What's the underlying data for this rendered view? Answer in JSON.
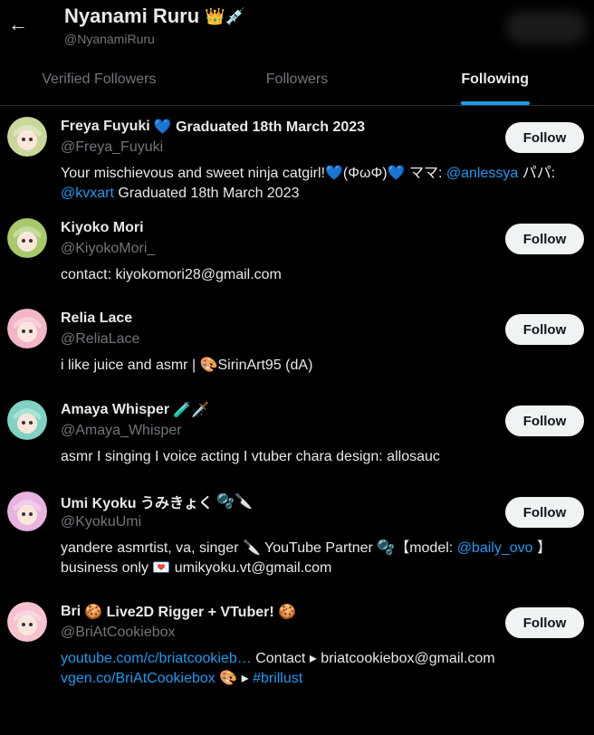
{
  "header": {
    "title": "Nyanami Ruru",
    "title_emoji": "👑💉",
    "handle": "@NyanamiRuru",
    "back_icon": "←"
  },
  "tabs": [
    {
      "label": "Verified Followers"
    },
    {
      "label": "Followers"
    },
    {
      "label": "Following"
    }
  ],
  "follow_label": "Follow",
  "users": [
    {
      "name": "Freya Fuyuki",
      "name_extra": "💙 Graduated 18th March 2023",
      "handle": "@Freya_Fuyuki",
      "bio": [
        {
          "t": "Your mischievous and sweet ninja catgirl!💙(ΦωΦ)💙 ママ: ",
          "link": false
        },
        {
          "t": "@anlessya",
          "link": true
        },
        {
          "t": " パパ: ",
          "link": false
        },
        {
          "t": "@kvxart",
          "link": true
        },
        {
          "t": " Graduated 18th March 2023",
          "link": false
        }
      ],
      "avatar_color": "#c9d79a"
    },
    {
      "name": "Kiyoko Mori",
      "name_extra": "",
      "handle": "@KiyokoMori_",
      "bio": [
        {
          "t": "contact: kiyokomori28@gmail.com",
          "link": false
        }
      ],
      "avatar_color": "#a8c96a"
    },
    {
      "name": "Relia Lace",
      "name_extra": "",
      "handle": "@ReliaLace",
      "bio": [
        {
          "t": "i like juice and asmr | 🎨SirinArt95 (dA)",
          "link": false
        }
      ],
      "avatar_color": "#f2b6c6"
    },
    {
      "name": "Amaya Whisper",
      "name_extra": "🧪🗡️",
      "handle": "@Amaya_Whisper",
      "bio": [
        {
          "t": "asmr I singing I voice acting I vtuber chara design: allosauc",
          "link": false
        }
      ],
      "avatar_color": "#7fd2c4"
    },
    {
      "name": "Umi Kyoku うみきょく",
      "name_extra": "🫧🔪",
      "handle": "@KyokuUmi",
      "bio": [
        {
          "t": "yandere asmrtist, va, singer 🔪 YouTube Partner 🫧【model: ",
          "link": false
        },
        {
          "t": "@baily_ovo",
          "link": true
        },
        {
          "t": " 】 business only 💌 umikyoku.vt@gmail.com",
          "link": false
        }
      ],
      "avatar_color": "#e9b3e0"
    },
    {
      "name": "Bri",
      "name_extra": "🍪 Live2D Rigger + VTuber! 🍪",
      "handle": "@BriAtCookiebox",
      "bio": [
        {
          "t": "youtube.com/c/briatcookieb…",
          "link": true
        },
        {
          "t": " Contact ▸ briatcookiebox@gmail.com ",
          "link": false
        },
        {
          "t": "vgen.co/BriAtCookiebox",
          "link": true
        },
        {
          "t": " 🎨 ▸ ",
          "link": false
        },
        {
          "t": "#brillust",
          "link": true
        }
      ],
      "avatar_color": "#f6c2cf"
    }
  ]
}
